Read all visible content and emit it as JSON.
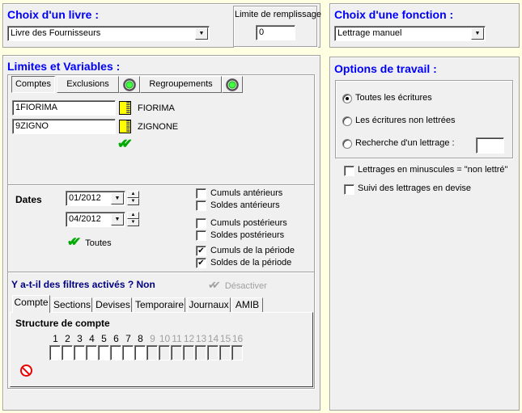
{
  "livre": {
    "title": "Choix d'un livre :",
    "selected": "Livre des Fournisseurs",
    "limite_label": "Limite de remplissage",
    "limite_value": "0"
  },
  "fonction": {
    "title": "Choix d'une fonction :",
    "selected": "Lettrage manuel"
  },
  "limites": {
    "title": "Limites et Variables :",
    "tabs": [
      "Comptes",
      "Exclusions",
      "Regroupements"
    ],
    "compte_from": "1FIORIMA",
    "compte_from_name": "FIORIMA",
    "compte_to": "9ZIGNO",
    "compte_to_name": "ZIGNONE",
    "dates_label": "Dates",
    "date_from": "01/2012",
    "date_to": "04/2012",
    "toutes_label": "Toutes",
    "checkboxes": [
      {
        "label": "Cumuls antérieurs",
        "checked": false
      },
      {
        "label": "Soldes antérieurs",
        "checked": false
      },
      {
        "label": "Cumuls postérieurs",
        "checked": false
      },
      {
        "label": "Soldes postérieurs",
        "checked": false
      },
      {
        "label": "Cumuls de la période",
        "checked": true
      },
      {
        "label": "Soldes de la période",
        "checked": true
      }
    ],
    "filtres_text": "Y a-t-il des filtres activés ? Non",
    "desactiver_label": "Désactiver",
    "filter_tabs": [
      "Compte",
      "Sections",
      "Devises",
      "Temporaire",
      "Journaux",
      "AMIB"
    ],
    "structure_label": "Structure de compte",
    "structure_numbers": [
      "1",
      "2",
      "3",
      "4",
      "5",
      "6",
      "7",
      "8",
      "9",
      "10",
      "11",
      "12",
      "13",
      "14",
      "15",
      "16"
    ],
    "structure_enabled_count": 8
  },
  "options": {
    "title": "Options de travail :",
    "radios": [
      {
        "label": "Toutes les écritures",
        "selected": true
      },
      {
        "label": "Les écritures non lettrées",
        "selected": false
      },
      {
        "label": "Recherche d'un lettrage :",
        "selected": false
      }
    ],
    "recherche_value": "",
    "checkboxes": [
      {
        "label": "Lettrages en minuscules = \"non lettré\"",
        "checked": false
      },
      {
        "label": "Suivi des lettrages en devise",
        "checked": false
      }
    ]
  },
  "colors": {
    "background": "#ffffe1",
    "panel": "#f0f0f0",
    "title": "#0000ff",
    "filter_text": "#000080"
  }
}
